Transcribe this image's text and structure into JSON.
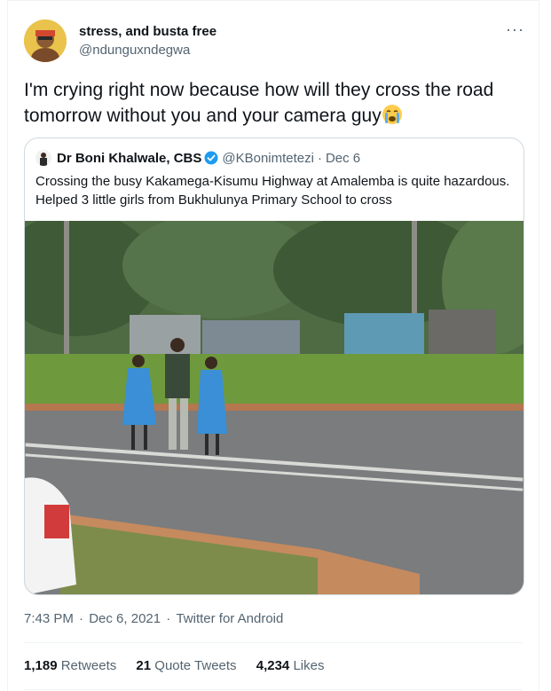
{
  "author": {
    "display_name": "stress, and busta free",
    "handle": "@ndunguxndegwa"
  },
  "tweet": {
    "text": "I'm crying right now because how will they cross the road tomorrow without you and your camera guy",
    "emoji_icon": "loudly-crying-face-emoji"
  },
  "quoted": {
    "display_name": "Dr Boni Khalwale, CBS",
    "handle": "@KBonimtetezi",
    "date": "Dec 6",
    "text": "Crossing the busy Kakamega-Kisumu Highway at Amalemba is quite hazardous. Helped 3 little girls from Bukhulunya Primary School to cross",
    "verified_color": "#1d9bf0"
  },
  "meta": {
    "time": "7:43 PM",
    "date": "Dec 6, 2021",
    "source": "Twitter for Android"
  },
  "stats": {
    "retweets_count": "1,189",
    "retweets_label": "Retweets",
    "quotes_count": "21",
    "quotes_label": "Quote Tweets",
    "likes_count": "4,234",
    "likes_label": "Likes"
  },
  "colors": {
    "text_primary": "#0f1419",
    "text_secondary": "#536471",
    "border": "#cfd9de"
  }
}
